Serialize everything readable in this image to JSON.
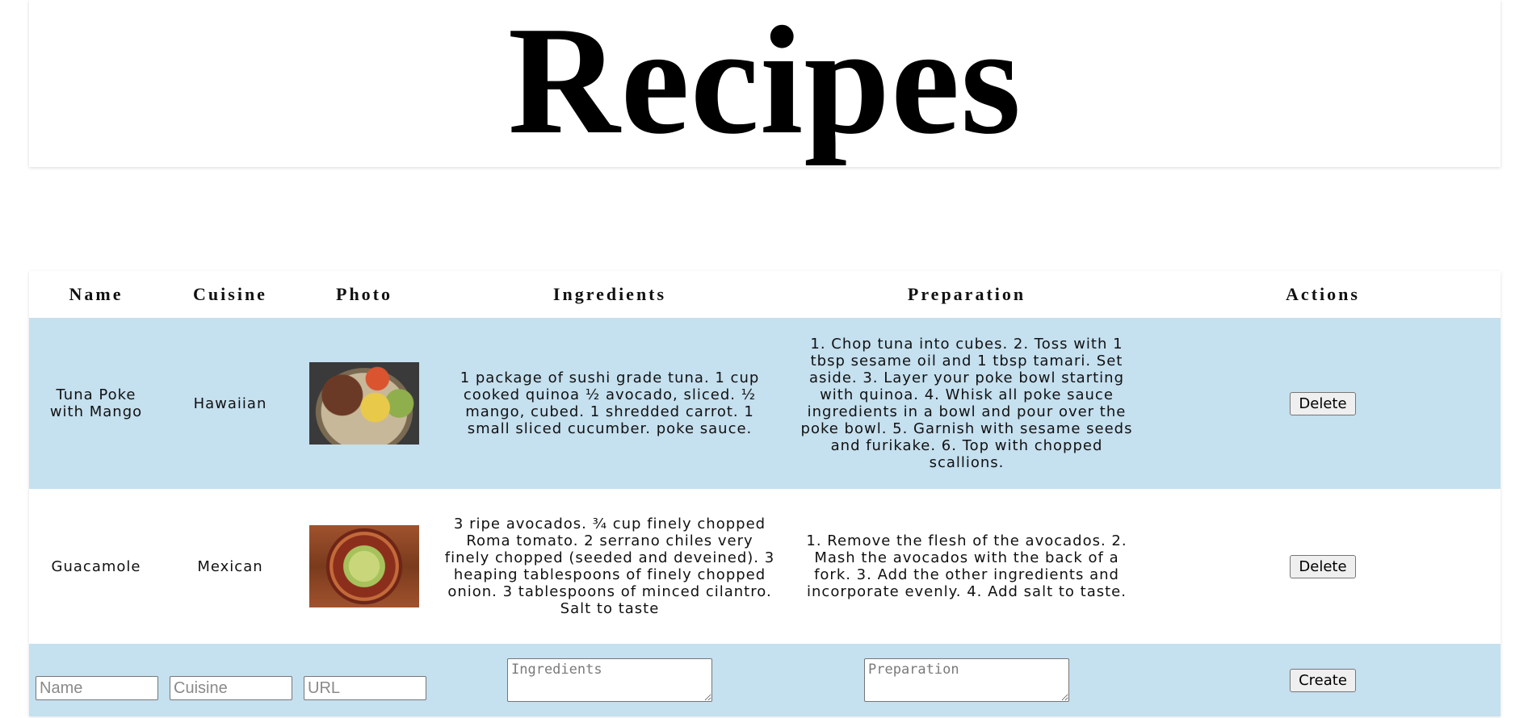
{
  "page": {
    "title": "Recipes"
  },
  "table": {
    "headers": [
      "Name",
      "Cuisine",
      "Photo",
      "Ingredients",
      "Preparation",
      "Actions"
    ],
    "rows": [
      {
        "name": "Tuna Poke with Mango",
        "cuisine": "Hawaiian",
        "photo": "poke-bowl-photo",
        "ingredients": "1 package of sushi grade tuna. 1 cup cooked quinoa ½ avocado, sliced. ½ mango, cubed. 1 shredded carrot. 1 small sliced cucumber. poke sauce.",
        "preparation": "1. Chop tuna into cubes. 2. Toss with 1 tbsp sesame oil and 1 tbsp tamari. Set aside. 3. Layer your poke bowl starting with quinoa. 4. Whisk all poke sauce ingredients in a bowl and pour over the poke bowl. 5. Garnish with sesame seeds and furikake. 6. Top with chopped scallions.",
        "action_label": "Delete"
      },
      {
        "name": "Guacamole",
        "cuisine": "Mexican",
        "photo": "guacamole-photo",
        "ingredients": "3 ripe avocados. ¾ cup finely chopped Roma tomato. 2 serrano chiles very finely chopped (seeded and deveined). 3 heaping tablespoons of finely chopped onion. 3 tablespoons of minced cilantro. Salt to taste",
        "preparation": "1. Remove the flesh of the avocados. 2. Mash the avocados with the back of a fork. 3. Add the other ingredients and incorporate evenly. 4. Add salt to taste.",
        "action_label": "Delete"
      }
    ],
    "new_row": {
      "name_placeholder": "Name",
      "cuisine_placeholder": "Cuisine",
      "url_placeholder": "URL",
      "ingredients_placeholder": "Ingredients",
      "preparation_placeholder": "Preparation",
      "create_label": "Create"
    }
  },
  "colors": {
    "row_highlight": "#c5e0ef",
    "background": "#ffffff"
  }
}
